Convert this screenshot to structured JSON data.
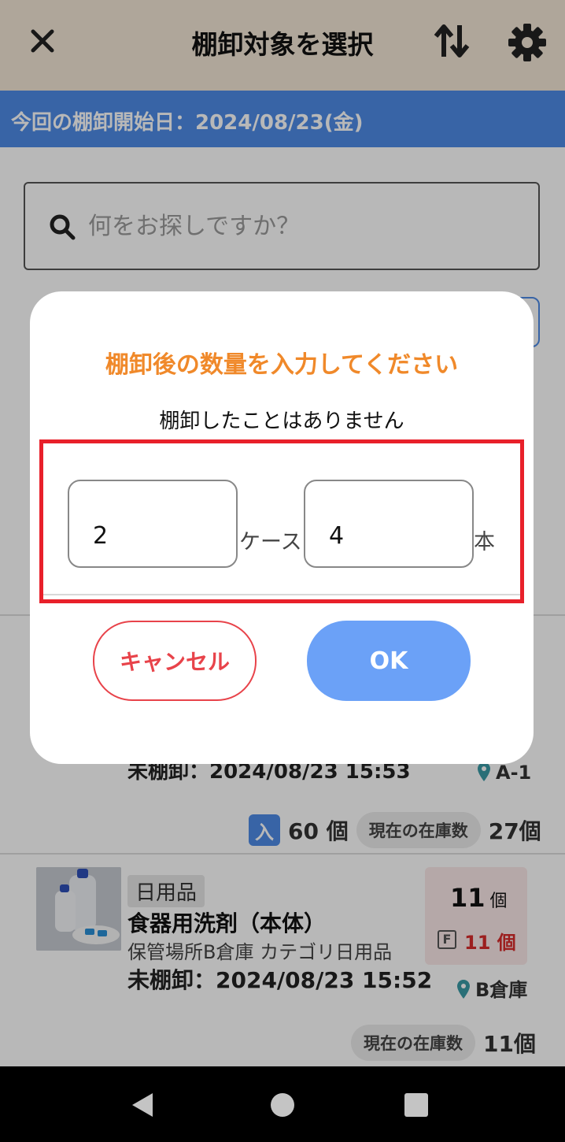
{
  "appbar": {
    "title": "棚卸対象を選択",
    "icons": [
      "close-icon",
      "sort-icon",
      "gear-icon"
    ]
  },
  "banner": {
    "text": "今回の棚卸開始日：2024/08/23(金)"
  },
  "search": {
    "placeholder": "何をお探しですか？"
  },
  "items": [
    {
      "status": "未棚卸：2024/08/23 15:53",
      "location": "A-1",
      "incoming_badge": "入",
      "incoming_qty": "60 個",
      "stock_label": "現在の在庫数",
      "stock_qty": "27個"
    },
    {
      "category": "日用品",
      "name": "食器用洗剤（本体）",
      "sub": "保管場所B倉庫 カテゴリ日用品",
      "status": "未棚卸：2024/08/23 15:52",
      "count": "11",
      "count_unit": "個",
      "f_badge": "F",
      "f_count": "11 個",
      "location": "B倉庫",
      "stock_label": "現在の在庫数",
      "stock_qty": "11個"
    }
  ],
  "dialog": {
    "title": "棚卸後の数量を入力してください",
    "subtitle": "棚卸したことはありません",
    "case_value": "2",
    "case_unit": "ケース",
    "piece_value": "4",
    "piece_unit": "本",
    "cancel_label": "キャンセル",
    "ok_label": "OK"
  },
  "colors": {
    "appbar_bg": "#f3e6d6",
    "banner_bg": "#4e8be6",
    "dialog_title": "#f0892a",
    "cancel": "#e8434a",
    "ok": "#6ba1f7",
    "highlight": "#e8202a"
  }
}
